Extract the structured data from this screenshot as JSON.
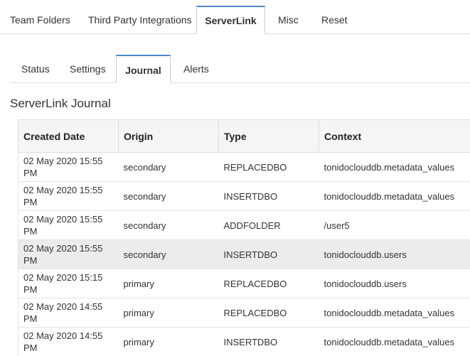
{
  "top_tabs": [
    {
      "label": "Team Folders"
    },
    {
      "label": "Third Party Integrations"
    },
    {
      "label": "ServerLink",
      "active": true
    },
    {
      "label": "Misc"
    },
    {
      "label": "Reset"
    }
  ],
  "sub_tabs": [
    {
      "label": "Status"
    },
    {
      "label": "Settings"
    },
    {
      "label": "Journal",
      "active": true
    },
    {
      "label": "Alerts"
    }
  ],
  "section_title": "ServerLink Journal",
  "table": {
    "headers": [
      "Created Date",
      "Origin",
      "Type",
      "Context"
    ],
    "rows": [
      {
        "date": "02 May 2020 15:55 PM",
        "origin": "secondary",
        "type": "REPLACEDBO",
        "context": "tonidoclouddb.metadata_values"
      },
      {
        "date": "02 May 2020 15:55 PM",
        "origin": "secondary",
        "type": "INSERTDBO",
        "context": "tonidoclouddb.metadata_values"
      },
      {
        "date": "02 May 2020 15:55 PM",
        "origin": "secondary",
        "type": "ADDFOLDER",
        "context": "/user5"
      },
      {
        "date": "02 May 2020 15:55 PM",
        "origin": "secondary",
        "type": "INSERTDBO",
        "context": "tonidoclouddb.users"
      },
      {
        "date": "02 May 2020 15:15 PM",
        "origin": "primary",
        "type": "REPLACEDBO",
        "context": "tonidoclouddb.users"
      },
      {
        "date": "02 May 2020 14:55 PM",
        "origin": "primary",
        "type": "REPLACEDBO",
        "context": "tonidoclouddb.metadata_values"
      },
      {
        "date": "02 May 2020 14:55 PM",
        "origin": "primary",
        "type": "INSERTDBO",
        "context": "tonidoclouddb.metadata_values"
      }
    ]
  },
  "colors": {
    "active_tab_accent": "#4a8ac9",
    "header_bg": "#f5f5f5",
    "hover_row_bg": "#ececec"
  }
}
